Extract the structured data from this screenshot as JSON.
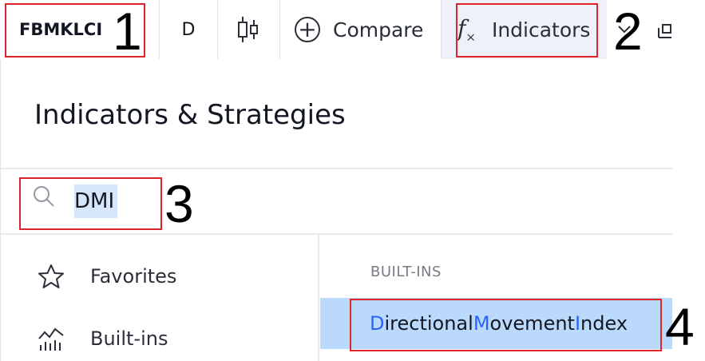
{
  "toolbar": {
    "symbol": "FBMKLCI",
    "interval": "D",
    "compare_label": "Compare",
    "indicators_label": "Indicators"
  },
  "annotations": [
    "1",
    "2",
    "3",
    "4"
  ],
  "dialog": {
    "title": "Indicators & Strategies",
    "search": {
      "value": "DMI",
      "placeholder": ""
    },
    "sidebar": [
      {
        "label": "Favorites",
        "icon": "star-icon"
      },
      {
        "label": "Built-ins",
        "icon": "chart-bars-icon"
      }
    ],
    "section_header": "BUILT-INS",
    "results": [
      {
        "parts": [
          "D",
          "irectional ",
          "M",
          "ovement ",
          "I",
          "ndex"
        ]
      }
    ]
  },
  "colors": {
    "annotation_frame": "#e0242c",
    "highlight_letter": "#2962ff",
    "selected_row": "#bbd9fb"
  }
}
